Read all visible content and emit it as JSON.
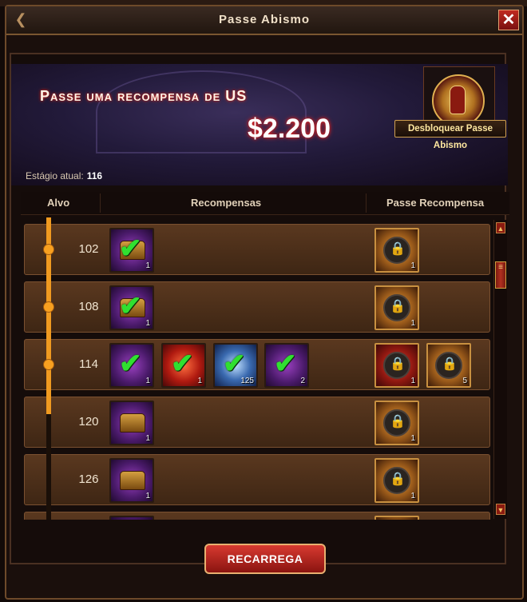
{
  "window": {
    "title": "Passe Abismo",
    "back_icon": "chevron-left-icon",
    "close_icon": "close-icon"
  },
  "banner": {
    "title": "Passe uma recompensa de US",
    "amount": "$2.200",
    "unlock_label": "Desbloquear Passe Abismo"
  },
  "stage": {
    "label": "Estágio atual:",
    "value": "116"
  },
  "columns": {
    "target": "Alvo",
    "rewards": "Recompensas",
    "pass_rewards": "Passe Recompensa"
  },
  "rows": [
    {
      "level": "102",
      "rewards": [
        {
          "type": "purple-chest",
          "claimed": true,
          "count": "1"
        }
      ],
      "pass_rewards": [
        {
          "type": "gold-chest",
          "locked": true,
          "count": "1"
        }
      ]
    },
    {
      "level": "108",
      "rewards": [
        {
          "type": "purple-chest",
          "claimed": true,
          "count": "1"
        }
      ],
      "pass_rewards": [
        {
          "type": "gold-chest",
          "locked": true,
          "count": "1"
        }
      ]
    },
    {
      "level": "114",
      "rewards": [
        {
          "type": "purple-item",
          "claimed": true,
          "count": "1"
        },
        {
          "type": "red-item",
          "claimed": true,
          "count": "1"
        },
        {
          "type": "blue-crystal",
          "claimed": true,
          "count": "125"
        },
        {
          "type": "purple-scroll",
          "claimed": true,
          "count": "2"
        }
      ],
      "pass_rewards": [
        {
          "type": "red-item",
          "locked": true,
          "count": "1"
        },
        {
          "type": "gold-scroll",
          "locked": true,
          "count": "5"
        }
      ]
    },
    {
      "level": "120",
      "rewards": [
        {
          "type": "gold-chest",
          "claimed": false,
          "count": "1"
        }
      ],
      "pass_rewards": [
        {
          "type": "gold-chest",
          "locked": true,
          "count": "1"
        }
      ]
    },
    {
      "level": "126",
      "rewards": [
        {
          "type": "gold-chest",
          "claimed": false,
          "count": "1"
        }
      ],
      "pass_rewards": [
        {
          "type": "gold-chest",
          "locked": true,
          "count": "1"
        }
      ]
    }
  ],
  "recharge_label": "RECARREGA"
}
